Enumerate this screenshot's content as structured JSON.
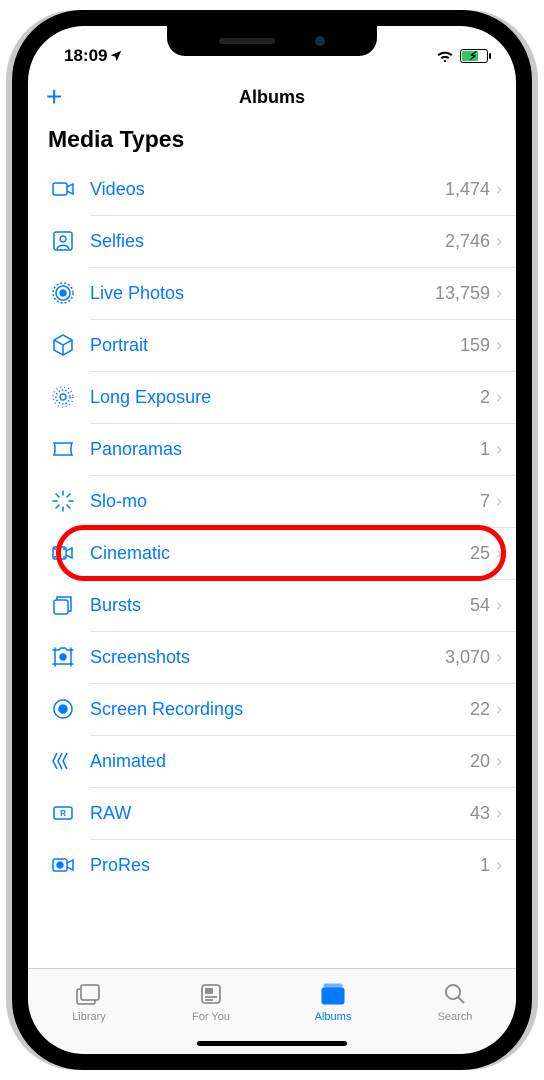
{
  "status": {
    "time": "18:09"
  },
  "nav": {
    "title": "Albums",
    "add_label": "+"
  },
  "section": {
    "header": "Media Types"
  },
  "rows": [
    {
      "icon": "video-icon",
      "label": "Videos",
      "count": "1,474"
    },
    {
      "icon": "person-crop-icon",
      "label": "Selfies",
      "count": "2,746"
    },
    {
      "icon": "live-photo-icon",
      "label": "Live Photos",
      "count": "13,759"
    },
    {
      "icon": "cube-icon",
      "label": "Portrait",
      "count": "159"
    },
    {
      "icon": "long-exposure-icon",
      "label": "Long Exposure",
      "count": "2"
    },
    {
      "icon": "panorama-icon",
      "label": "Panoramas",
      "count": "1"
    },
    {
      "icon": "slomo-icon",
      "label": "Slo-mo",
      "count": "7"
    },
    {
      "icon": "cinematic-icon",
      "label": "Cinematic",
      "count": "25",
      "highlight": true
    },
    {
      "icon": "burst-icon",
      "label": "Bursts",
      "count": "54"
    },
    {
      "icon": "screenshot-icon",
      "label": "Screenshots",
      "count": "3,070"
    },
    {
      "icon": "record-icon",
      "label": "Screen Recordings",
      "count": "22"
    },
    {
      "icon": "animated-icon",
      "label": "Animated",
      "count": "20"
    },
    {
      "icon": "raw-icon",
      "label": "RAW",
      "count": "43"
    },
    {
      "icon": "prores-icon",
      "label": "ProRes",
      "count": "1"
    }
  ],
  "tabs": [
    {
      "icon": "library-tab-icon",
      "label": "Library"
    },
    {
      "icon": "foryou-tab-icon",
      "label": "For You"
    },
    {
      "icon": "albums-tab-icon",
      "label": "Albums",
      "active": true
    },
    {
      "icon": "search-tab-icon",
      "label": "Search"
    }
  ]
}
